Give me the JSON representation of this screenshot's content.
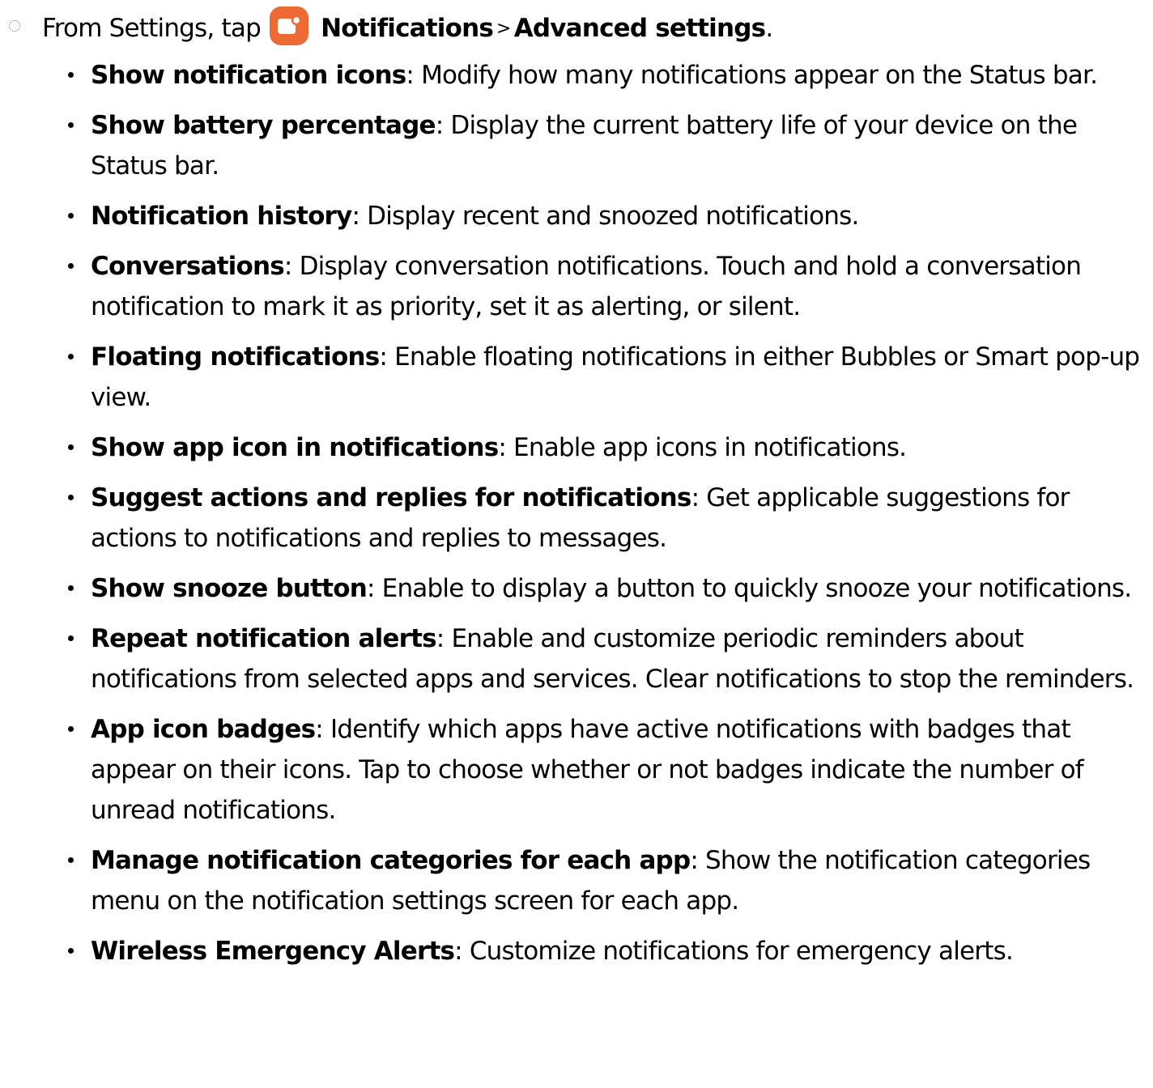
{
  "step": {
    "intro": "From Settings, tap",
    "target1": "Notifications",
    "separator": ">",
    "target2": "Advanced settings",
    "period": ".",
    "icon": "notifications-app-icon",
    "icon_color": "#ee6a34"
  },
  "items": [
    {
      "term": "Show notification icons",
      "desc": ": Modify how many notifications appear on the Status bar."
    },
    {
      "term": "Show battery percentage",
      "desc": ": Display the current battery life of your device on the Status bar."
    },
    {
      "term": "Notification history",
      "desc": ": Display recent and snoozed notifications."
    },
    {
      "term": "Conversations",
      "desc": ": Display conversation notifications. Touch and hold a conversation notification to mark it as priority, set it as alerting, or silent."
    },
    {
      "term": "Floating notifications",
      "desc": ": Enable floating notifications in either Bubbles or Smart pop-up view."
    },
    {
      "term": "Show app icon in notifications",
      "desc": ": Enable app icons in notifications."
    },
    {
      "term": "Suggest actions and replies for notifications",
      "desc": ": Get applicable suggestions for actions to notifications and replies to messages."
    },
    {
      "term": "Show snooze button",
      "desc": ": Enable to display a button to quickly snooze your notifications."
    },
    {
      "term": "Repeat notification alerts",
      "desc": ": Enable and customize periodic reminders about notifications from selected apps and services. Clear notifications to stop the reminders."
    },
    {
      "term": "App icon badges",
      "desc": ": Identify which apps have active notifications with badges that appear on their icons. Tap to choose whether or not badges indicate the number of unread notifications."
    },
    {
      "term": "Manage notification categories for each app",
      "desc": ": Show the notification categories menu on the notification settings screen for each app."
    },
    {
      "term": "Wireless Emergency Alerts",
      "desc": ": Customize notifications for emergency alerts."
    }
  ]
}
